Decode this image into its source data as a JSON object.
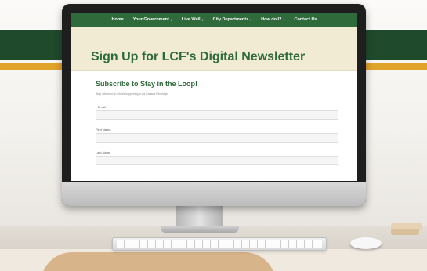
{
  "nav": {
    "items": [
      {
        "label": "Home",
        "dropdown": false
      },
      {
        "label": "Your Government",
        "dropdown": true
      },
      {
        "label": "Live Well",
        "dropdown": true
      },
      {
        "label": "City Departments",
        "dropdown": true
      },
      {
        "label": "How do I?",
        "dropdown": true
      },
      {
        "label": "Contact Us",
        "dropdown": false
      }
    ],
    "chevron": "▾"
  },
  "hero": {
    "title": "Sign Up for LCF's Digital Newsletter"
  },
  "form": {
    "title": "Subscribe to Stay in the Loop!",
    "subtitle": "Stay informed on what's happening in La Cañada Flintridge.",
    "required_marker": "*",
    "fields": [
      {
        "label": "Email",
        "required": true,
        "value": ""
      },
      {
        "label": "First Name",
        "required": false,
        "value": ""
      },
      {
        "label": "Last Name",
        "required": false,
        "value": ""
      }
    ]
  },
  "colors": {
    "brand_green": "#2f6a3b",
    "band_green": "#1f4a2c",
    "band_gold": "#e1a42a",
    "hero_background": "#f0ebd2"
  }
}
